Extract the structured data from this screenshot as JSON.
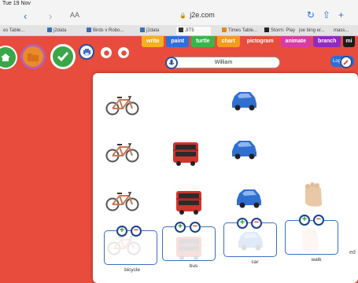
{
  "browser": {
    "status_time": "Tue 19 Nov",
    "aa_label": "AA",
    "url": "j2e.com",
    "tabs": [
      {
        "label": "es Table..."
      },
      {
        "label": "j2data"
      },
      {
        "label": "Birds v Robo..."
      },
      {
        "label": "j2data"
      },
      {
        "label": "JIT5"
      },
      {
        "label": "Times Table..."
      },
      {
        "label": "Storm: Play"
      },
      {
        "label": "joe bing er..."
      },
      {
        "label": "mass..."
      }
    ]
  },
  "menu": [
    {
      "label": "write",
      "color": "#f2b21f"
    },
    {
      "label": "paint",
      "color": "#2e6fe0"
    },
    {
      "label": "turtle",
      "color": "#39b54a"
    },
    {
      "label": "chart",
      "color": "#f29b1d"
    },
    {
      "label": "pictogram",
      "color": "#e74c3c"
    },
    {
      "label": "animate",
      "color": "#d83aa6"
    },
    {
      "label": "branch",
      "color": "#8e2bc4"
    },
    {
      "label": "mi",
      "color": "#1c1c1c"
    }
  ],
  "author_name": "William",
  "side_tab_label": "Login",
  "columns": [
    {
      "label": "bicycle"
    },
    {
      "label": "bus"
    },
    {
      "label": "car"
    },
    {
      "label": "walk"
    }
  ],
  "counts": {
    "bicycle": 4,
    "bus": 3,
    "car": 4,
    "walk": 2
  },
  "corner_label": "ed",
  "colors": {
    "background": "#e74c3c",
    "canvas": "#ffffff",
    "accent": "#2a4f9f",
    "plus": "#2d9b2d",
    "minus": "#d23b2b"
  }
}
